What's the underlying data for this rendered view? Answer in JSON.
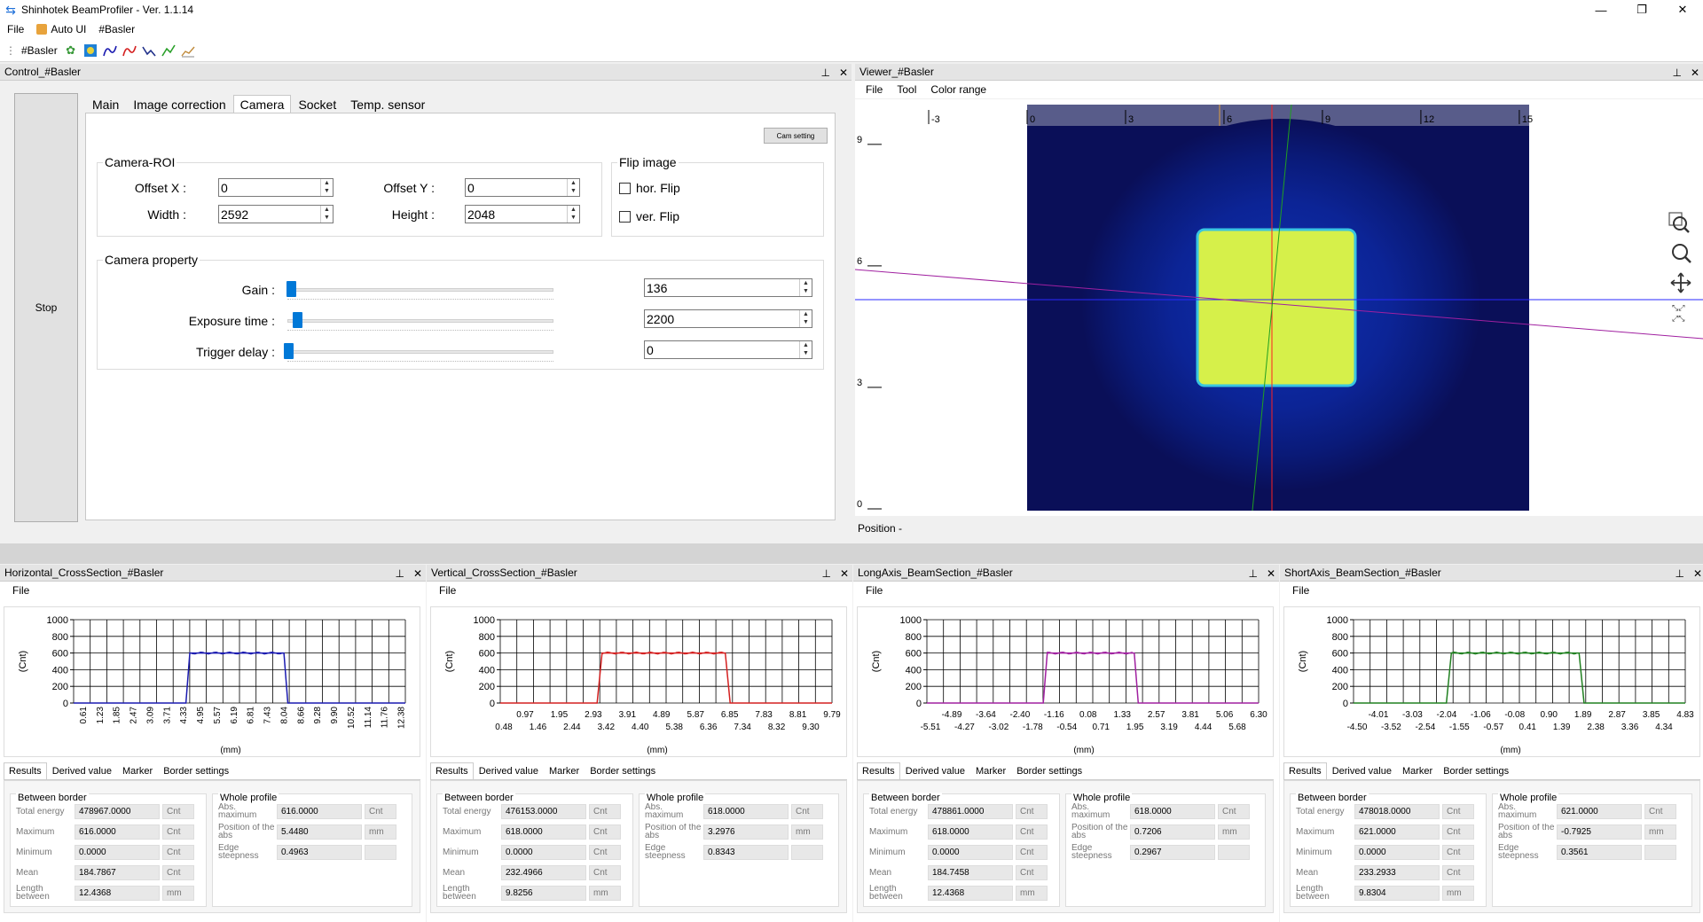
{
  "window": {
    "title": "Shinhotek BeamProfiler - Ver. 1.1.14"
  },
  "menubar": {
    "file": "File",
    "auto_ui": "Auto UI",
    "basler": "#Basler"
  },
  "toolbar": {
    "label": "#Basler",
    "icons": [
      "settings-icon",
      "camera-icon",
      "profile-blue-icon",
      "profile-red-icon",
      "profile-navy-icon",
      "profile-green-icon",
      "chart-icon"
    ]
  },
  "control": {
    "title": "Control_#Basler",
    "stop_label": "Stop",
    "tabs": [
      "Main",
      "Image correction",
      "Camera",
      "Socket",
      "Temp. sensor"
    ],
    "active_tab": "Camera",
    "cam_setting_label": "Cam setting",
    "roi": {
      "title": "Camera-ROI",
      "offset_x_label": "Offset X :",
      "offset_x": "0",
      "offset_y_label": "Offset Y :",
      "offset_y": "0",
      "width_label": "Width :",
      "width": "2592",
      "height_label": "Height :",
      "height": "2048"
    },
    "flip": {
      "title": "Flip image",
      "hor_label": "hor. Flip",
      "ver_label": "ver. Flip",
      "hor": false,
      "ver": false
    },
    "property": {
      "title": "Camera property",
      "gain_label": "Gain :",
      "gain": "136",
      "gain_frac": 0.01,
      "exposure_label": "Exposure time :",
      "exposure": "2200",
      "exposure_frac": 0.035,
      "trigger_label": "Trigger delay :",
      "trigger": "0",
      "trigger_frac": 0.0
    }
  },
  "viewer": {
    "title": "Viewer_#Basler",
    "menu": [
      "File",
      "Tool",
      "Color range"
    ],
    "x_ticks": [
      "-3",
      "0",
      "3",
      "6",
      "9",
      "12",
      "15"
    ],
    "y_ticks": [
      "9",
      "6",
      "3",
      "0"
    ],
    "status": "Position -",
    "colors": {
      "background": "#0a0f58",
      "halo": "#0b1f8a",
      "beam": "#d6f04a",
      "beam_edge": "#39c5e0"
    }
  },
  "panels": [
    {
      "title": "Horizontal_CrossSection_#Basler",
      "menu": "File",
      "line_color": "#1a1ab0",
      "ylabel": "(Cnt)",
      "xlabel": "(mm)",
      "y_ticks": [
        "1000",
        "800",
        "600",
        "400",
        "200",
        "0"
      ],
      "x_ticks_rotated": [
        "0.61",
        "1.23",
        "1.85",
        "2.47",
        "3.09",
        "3.71",
        "4.33",
        "4.95",
        "5.57",
        "6.19",
        "6.81",
        "7.43",
        "8.04",
        "8.66",
        "9.28",
        "9.90",
        "10.52",
        "11.14",
        "11.76",
        "12.38"
      ],
      "x_ticks_top": [],
      "x_ticks_bottom": [],
      "chart_data": {
        "type": "line",
        "ylim": [
          0,
          1000
        ],
        "xlim": [
          0.0,
          12.7
        ],
        "x": [
          0.0,
          4.3,
          4.45,
          8.05,
          8.2,
          12.7
        ],
        "y": [
          0,
          0,
          600,
          600,
          0,
          0
        ]
      },
      "tabs": [
        "Results",
        "Derived value",
        "Marker",
        "Border settings"
      ],
      "between_title": "Between border",
      "whole_title": "Whole profile",
      "between": [
        {
          "label": "Total energy",
          "value": "478967.0000",
          "unit": "Cnt"
        },
        {
          "label": "Maximum",
          "value": "616.0000",
          "unit": "Cnt"
        },
        {
          "label": "Minimum",
          "value": "0.0000",
          "unit": "Cnt"
        },
        {
          "label": "Mean",
          "value": "184.7867",
          "unit": "Cnt"
        },
        {
          "label": "Length between",
          "value": "12.4368",
          "unit": "mm"
        }
      ],
      "whole": [
        {
          "label": "Abs. maximum",
          "value": "616.0000",
          "unit": "Cnt"
        },
        {
          "label": "Position of the abs",
          "value": "5.4480",
          "unit": "mm"
        },
        {
          "label": "Edge steepness",
          "value": "0.4963",
          "unit": ""
        }
      ]
    },
    {
      "title": "Vertical_CrossSection_#Basler",
      "menu": "File",
      "line_color": "#d42020",
      "ylabel": "(Cnt)",
      "xlabel": "(mm)",
      "y_ticks": [
        "1000",
        "800",
        "600",
        "400",
        "200",
        "0"
      ],
      "x_ticks_rotated": [],
      "x_ticks_top": [
        "0.97",
        "1.95",
        "2.93",
        "3.91",
        "4.89",
        "5.87",
        "6.85",
        "7.83",
        "8.81",
        "9.79"
      ],
      "x_ticks_bottom": [
        "0.48",
        "1.46",
        "2.44",
        "3.42",
        "4.40",
        "5.38",
        "6.36",
        "7.34",
        "8.32",
        "9.30"
      ],
      "chart_data": {
        "type": "line",
        "ylim": [
          0,
          1000
        ],
        "xlim": [
          0.0,
          10.1
        ],
        "x": [
          0.0,
          2.95,
          3.1,
          6.85,
          7.0,
          10.1
        ],
        "y": [
          0,
          0,
          600,
          600,
          0,
          0
        ]
      },
      "tabs": [
        "Results",
        "Derived value",
        "Marker",
        "Border settings"
      ],
      "between_title": "Between border",
      "whole_title": "Whole profile",
      "between": [
        {
          "label": "Total energy",
          "value": "476153.0000",
          "unit": "Cnt"
        },
        {
          "label": "Maximum",
          "value": "618.0000",
          "unit": "Cnt"
        },
        {
          "label": "Minimum",
          "value": "0.0000",
          "unit": "Cnt"
        },
        {
          "label": "Mean",
          "value": "232.4966",
          "unit": "Cnt"
        },
        {
          "label": "Length between",
          "value": "9.8256",
          "unit": "mm"
        }
      ],
      "whole": [
        {
          "label": "Abs. maximum",
          "value": "618.0000",
          "unit": "Cnt"
        },
        {
          "label": "Position of the abs",
          "value": "3.2976",
          "unit": "mm"
        },
        {
          "label": "Edge steepness",
          "value": "0.8343",
          "unit": ""
        }
      ]
    },
    {
      "title": "LongAxis_BeamSection_#Basler",
      "menu": "File",
      "line_color": "#a020a0",
      "ylabel": "(Cnt)",
      "xlabel": "(mm)",
      "y_ticks": [
        "1000",
        "800",
        "600",
        "400",
        "200",
        "0"
      ],
      "x_ticks_rotated": [],
      "x_ticks_top": [
        "-4.89",
        "-3.64",
        "-2.40",
        "-1.16",
        "0.08",
        "1.33",
        "2.57",
        "3.81",
        "5.06",
        "6.30"
      ],
      "x_ticks_bottom": [
        "-5.51",
        "-4.27",
        "-3.02",
        "-1.78",
        "-0.54",
        "0.71",
        "1.95",
        "3.19",
        "4.44",
        "5.68"
      ],
      "chart_data": {
        "type": "line",
        "ylim": [
          0,
          1000
        ],
        "xlim": [
          -5.9,
          6.5
        ],
        "x": [
          -5.9,
          -1.55,
          -1.4,
          1.85,
          2.0,
          6.5
        ],
        "y": [
          0,
          0,
          600,
          600,
          0,
          0
        ]
      },
      "tabs": [
        "Results",
        "Derived value",
        "Marker",
        "Border settings"
      ],
      "between_title": "Between border",
      "whole_title": "Whole profile",
      "between": [
        {
          "label": "Total energy",
          "value": "478861.0000",
          "unit": "Cnt"
        },
        {
          "label": "Maximum",
          "value": "618.0000",
          "unit": "Cnt"
        },
        {
          "label": "Minimum",
          "value": "0.0000",
          "unit": "Cnt"
        },
        {
          "label": "Mean",
          "value": "184.7458",
          "unit": "Cnt"
        },
        {
          "label": "Length between",
          "value": "12.4368",
          "unit": "mm"
        }
      ],
      "whole": [
        {
          "label": "Abs. maximum",
          "value": "618.0000",
          "unit": "Cnt"
        },
        {
          "label": "Position of the abs",
          "value": "0.7206",
          "unit": "mm"
        },
        {
          "label": "Edge steepness",
          "value": "0.2967",
          "unit": ""
        }
      ]
    },
    {
      "title": "ShortAxis_BeamSection_#Basler",
      "menu": "File",
      "line_color": "#208020",
      "ylabel": "(Cnt)",
      "xlabel": "(mm)",
      "y_ticks": [
        "1000",
        "800",
        "600",
        "400",
        "200",
        "0"
      ],
      "x_ticks_rotated": [],
      "x_ticks_top": [
        "-4.01",
        "-3.03",
        "-2.04",
        "-1.06",
        "-0.08",
        "0.90",
        "1.89",
        "2.87",
        "3.85",
        "4.83"
      ],
      "x_ticks_bottom": [
        "-4.50",
        "-3.52",
        "-2.54",
        "-1.55",
        "-0.57",
        "0.41",
        "1.39",
        "2.38",
        "3.36",
        "4.34"
      ],
      "chart_data": {
        "type": "line",
        "ylim": [
          0,
          1000
        ],
        "xlim": [
          -4.9,
          5.1
        ],
        "x": [
          -4.9,
          -2.1,
          -1.95,
          1.9,
          2.05,
          5.1
        ],
        "y": [
          0,
          0,
          600,
          600,
          0,
          0
        ]
      },
      "tabs": [
        "Results",
        "Derived value",
        "Marker",
        "Border settings"
      ],
      "between_title": "Between border",
      "whole_title": "Whole profile",
      "between": [
        {
          "label": "Total energy",
          "value": "478018.0000",
          "unit": "Cnt"
        },
        {
          "label": "Maximum",
          "value": "621.0000",
          "unit": "Cnt"
        },
        {
          "label": "Minimum",
          "value": "0.0000",
          "unit": "Cnt"
        },
        {
          "label": "Mean",
          "value": "233.2933",
          "unit": "Cnt"
        },
        {
          "label": "Length between",
          "value": "9.8304",
          "unit": "mm"
        }
      ],
      "whole": [
        {
          "label": "Abs. maximum",
          "value": "621.0000",
          "unit": "Cnt"
        },
        {
          "label": "Position of the abs",
          "value": "-0.7925",
          "unit": "mm"
        },
        {
          "label": "Edge steepness",
          "value": "0.3561",
          "unit": ""
        }
      ]
    }
  ]
}
